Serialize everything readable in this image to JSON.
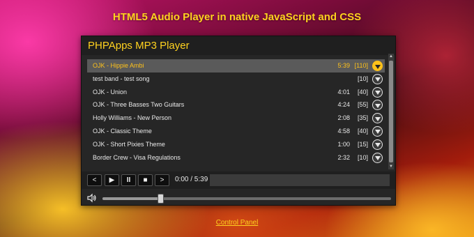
{
  "page": {
    "title": "HTML5 Audio Player in native JavaScript and CSS",
    "control_panel_link": "Control Panel"
  },
  "player": {
    "title": "PHPApps MP3 Player",
    "tracks": [
      {
        "title": "OJK - Hippie Ambi",
        "duration": "5:39",
        "count": "[110]",
        "active": true
      },
      {
        "title": "test band - test song",
        "duration": "",
        "count": "[10]",
        "active": false
      },
      {
        "title": "OJK - Union",
        "duration": "4:01",
        "count": "[40]",
        "active": false
      },
      {
        "title": "OJK - Three Basses Two Guitars",
        "duration": "4:24",
        "count": "[55]",
        "active": false
      },
      {
        "title": "Holly Williams - New Person",
        "duration": "2:08",
        "count": "[35]",
        "active": false
      },
      {
        "title": "OJK - Classic Theme",
        "duration": "4:58",
        "count": "[40]",
        "active": false
      },
      {
        "title": "OJK - Short Pixies Theme",
        "duration": "1:00",
        "count": "[15]",
        "active": false
      },
      {
        "title": "Border Crew - Visa Regulations",
        "duration": "2:32",
        "count": "[10]",
        "active": false
      }
    ],
    "controls": {
      "prev_label": "<",
      "play_label": "▶",
      "pause_label": "II",
      "stop_label": "■",
      "next_label": ">",
      "time": "0:00 / 5:39"
    },
    "volume": {
      "level_percent": 20,
      "icon": "speaker-icon"
    }
  },
  "colors": {
    "accent": "#ffd21f",
    "active_track_text": "#ffc21a",
    "panel_bg": "#262626"
  }
}
